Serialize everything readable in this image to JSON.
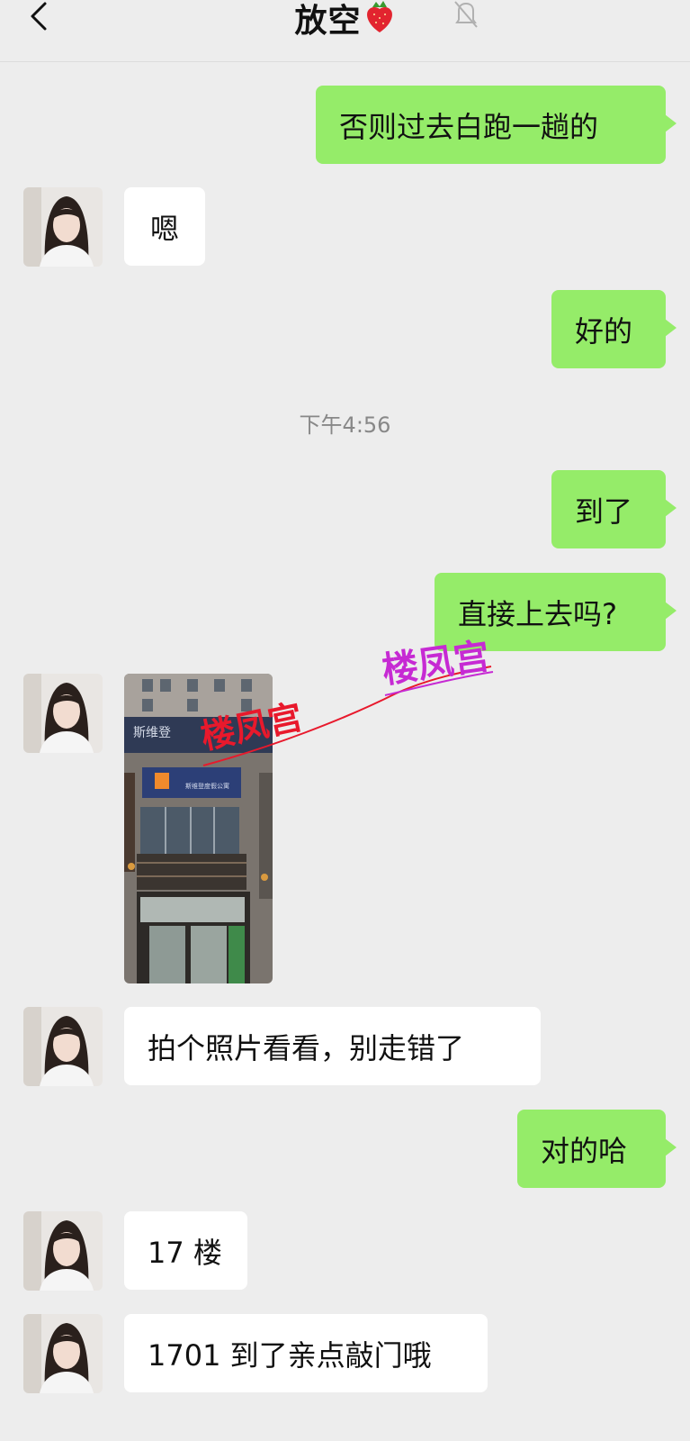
{
  "header": {
    "title": "放空",
    "title_emoji": "strawberry-emoji",
    "back_icon": "chevron-left-icon",
    "mute_icon": "bell-muted-icon"
  },
  "messages": [
    {
      "side": "sent",
      "text": "否则过去白跑一趟的"
    },
    {
      "side": "received",
      "text": "嗯"
    },
    {
      "side": "sent",
      "text": "好的"
    },
    {
      "timestamp": "下午4:56"
    },
    {
      "side": "sent",
      "text": "到了"
    },
    {
      "side": "sent",
      "text": "直接上去吗?"
    },
    {
      "side": "received",
      "type": "image",
      "image_texts": [
        "斯维登",
        "斯维登度假公寓"
      ]
    },
    {
      "side": "received",
      "text": "拍个照片看看，别走错了"
    },
    {
      "side": "sent",
      "text": "对的哈"
    },
    {
      "side": "received",
      "text": "17 楼"
    },
    {
      "side": "received",
      "text": "1701 到了亲点敲门哦"
    }
  ],
  "watermarks": [
    "楼凤宫",
    "楼凤宫"
  ],
  "colors": {
    "background": "#ededed",
    "sent_bubble": "#95ec69",
    "received_bubble": "#ffffff",
    "watermark_red": "#e8192c",
    "watermark_purple": "#c62ad3"
  }
}
